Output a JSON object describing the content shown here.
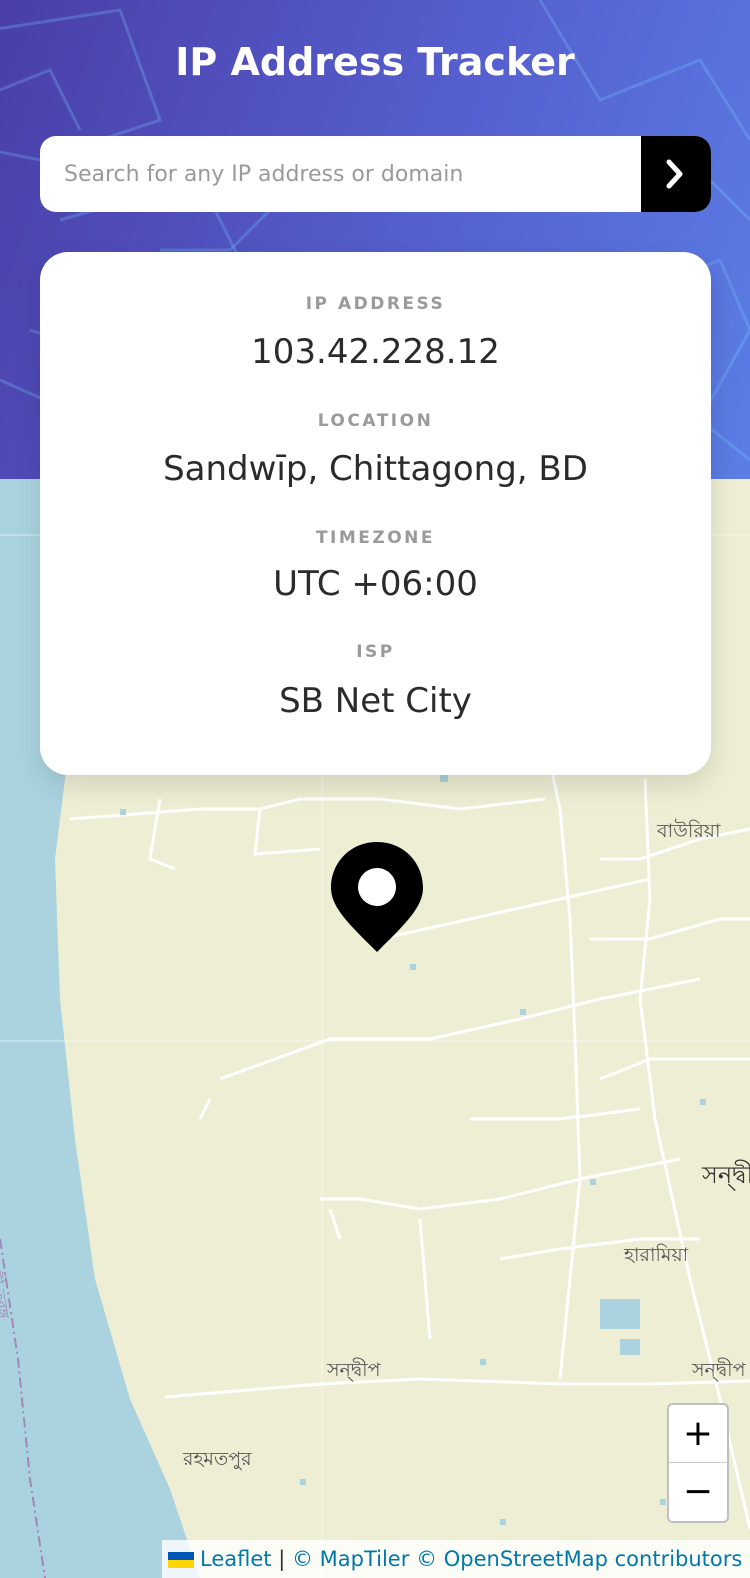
{
  "header": {
    "title": "IP Address Tracker"
  },
  "search": {
    "placeholder": "Search for any IP address or domain",
    "value": "",
    "button_icon": "chevron-right-icon"
  },
  "info": {
    "ip_label": "IP ADDRESS",
    "ip_value": "103.42.228.12",
    "location_label": "LOCATION",
    "location_value": "Sandwīp, Chittagong, BD",
    "timezone_label": "TIMEZONE",
    "timezone_value": "UTC +06:00",
    "isp_label": "ISP",
    "isp_value": "SB Net City"
  },
  "map": {
    "places": [
      "বাউরিয়া",
      "সন্দ্বী",
      "হারামিয়া",
      "সন্দ্বীপ",
      "সন্দ্বীপ",
      "রহমতপুর",
      "নদী তরঙ্গ"
    ],
    "zoom_in_label": "+",
    "zoom_out_label": "−",
    "marker_icon": "location-pin-icon"
  },
  "attribution": {
    "leaflet": "Leaflet",
    "separator": "|",
    "maptiler": "© MapTiler",
    "osm": "© OpenStreetMap contributors"
  },
  "colors": {
    "header_start": "#4a3ea8",
    "header_end": "#5b7ee6",
    "land": "#eeeed4",
    "water": "#aad3df",
    "link": "#0078a8"
  }
}
